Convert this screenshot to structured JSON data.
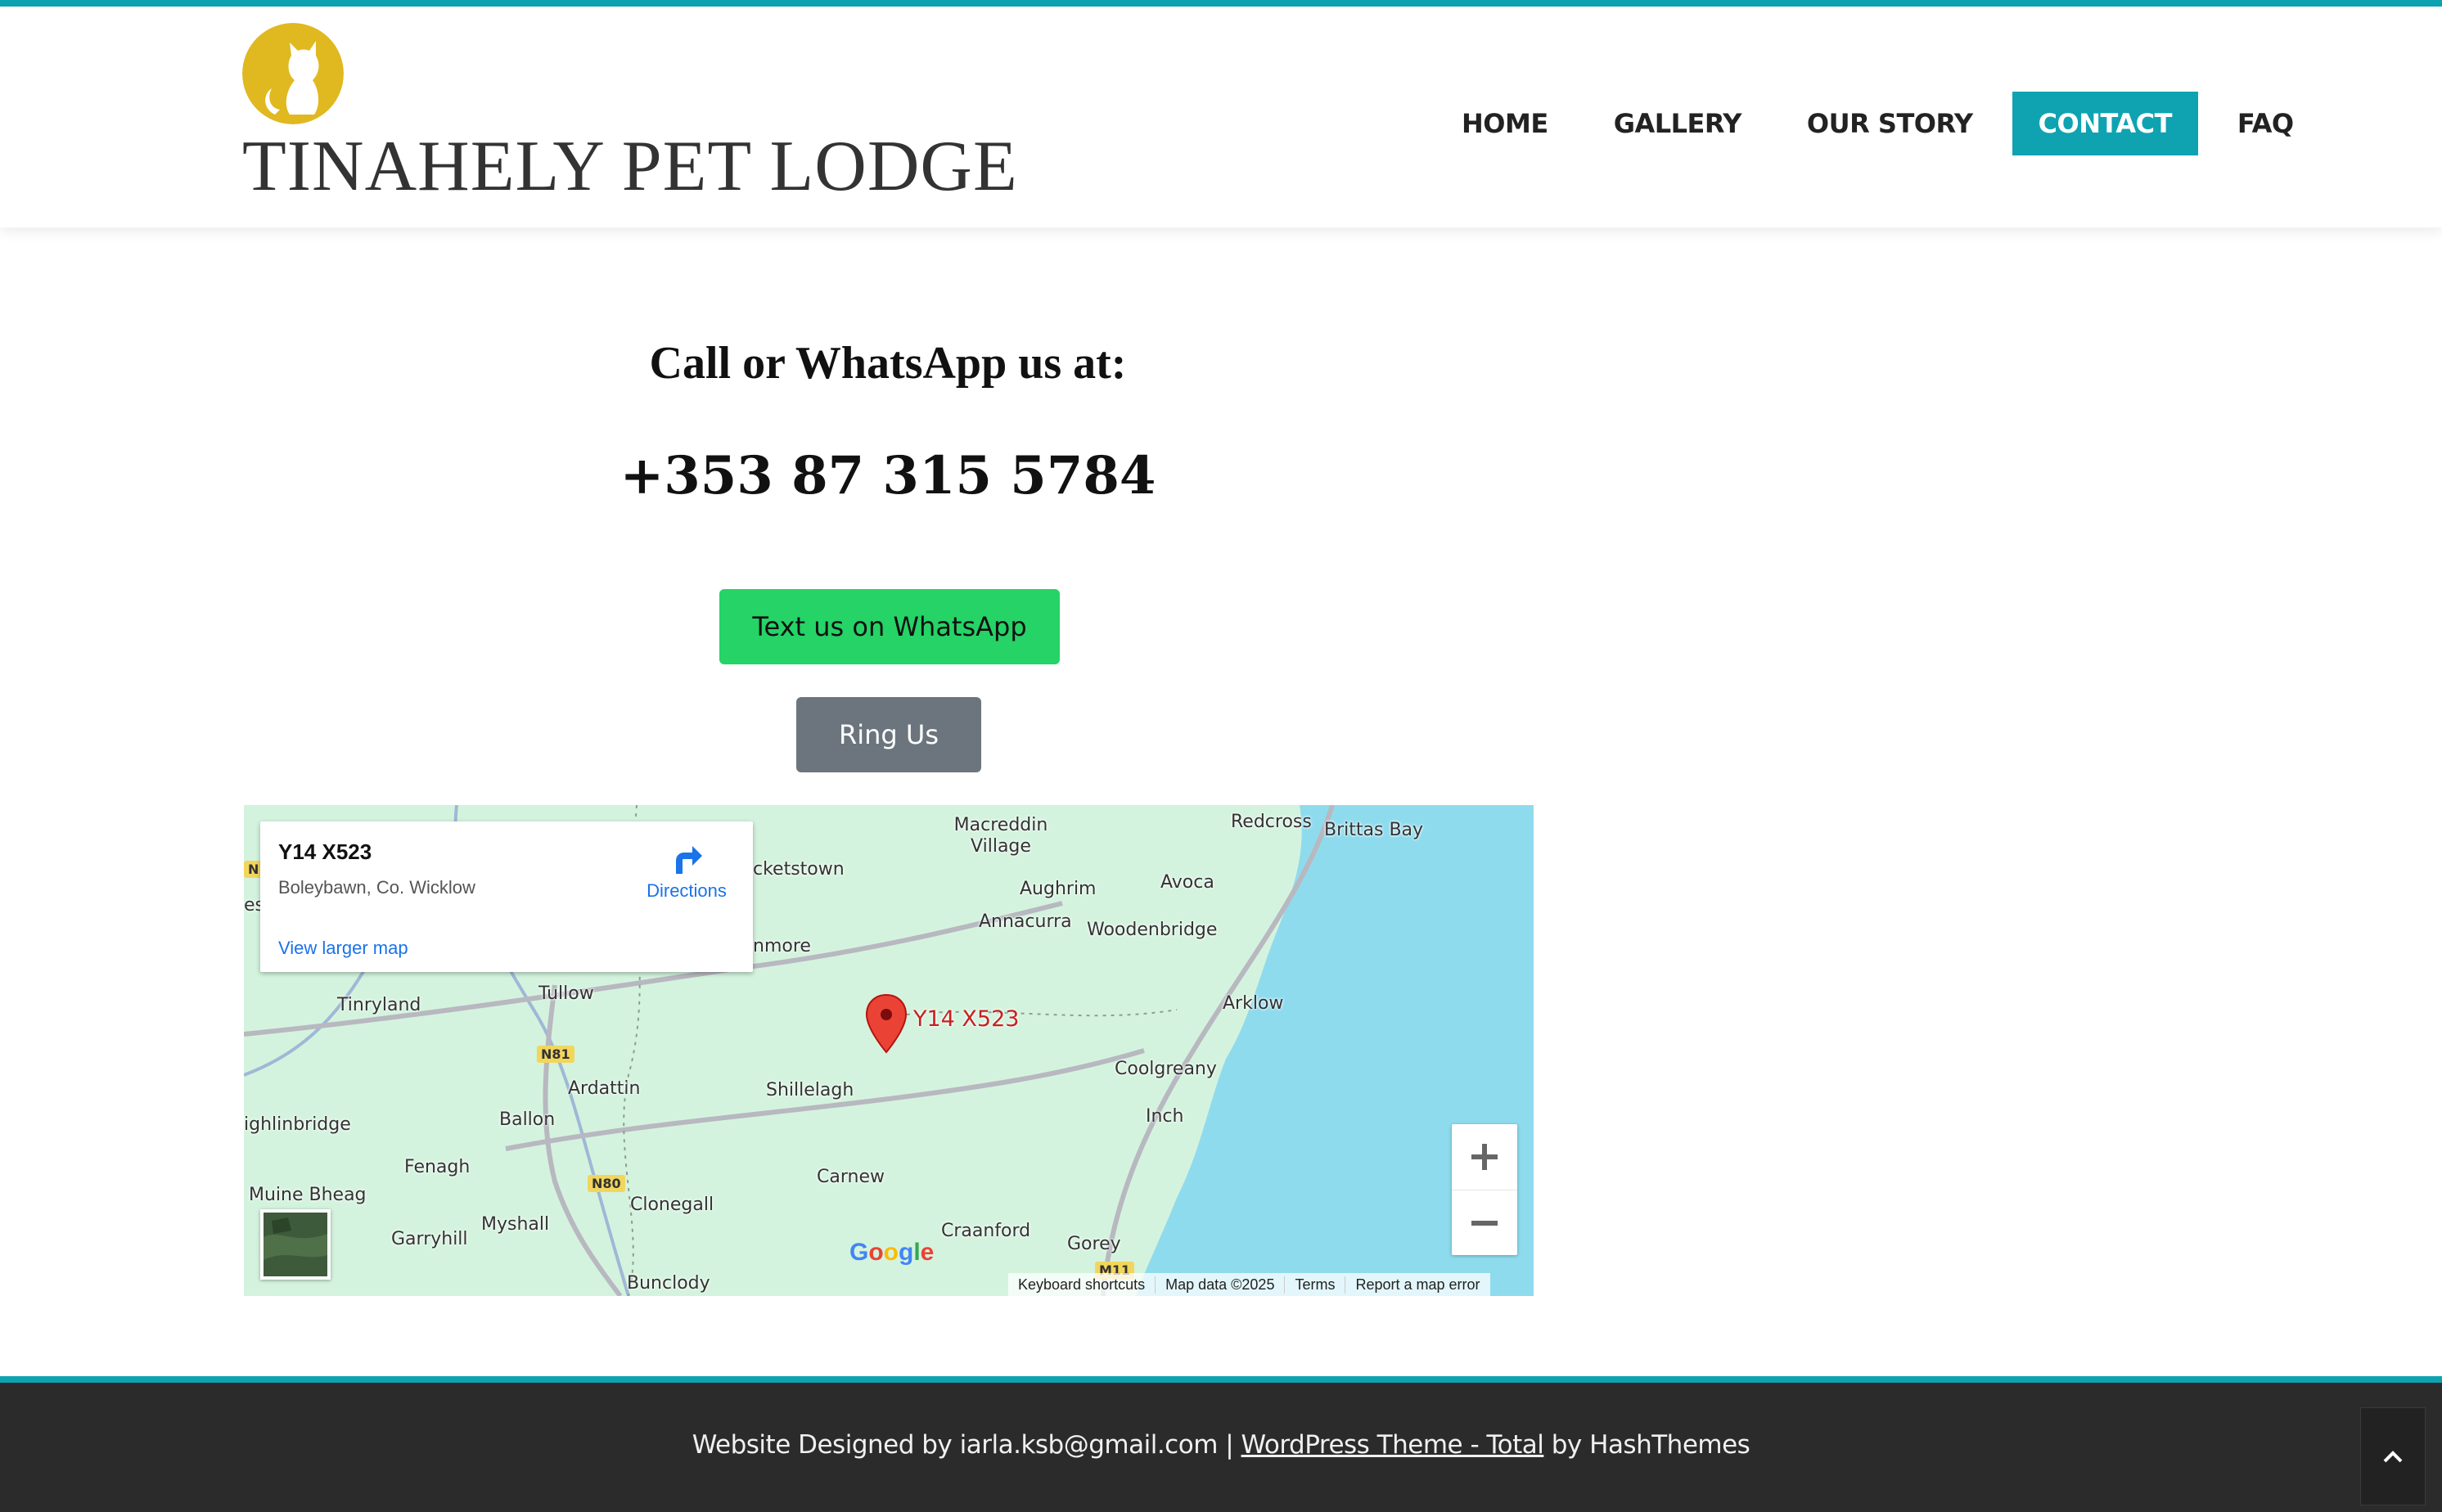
{
  "colors": {
    "accent": "#0fa3b1",
    "logo": "#e0b820",
    "whatsapp": "#25d366",
    "ring": "#6c757d",
    "footer_bg": "#2b2b2b",
    "map_land": "#d4f3de",
    "map_water": "#8fdbee",
    "pin": "#ea4335"
  },
  "header": {
    "logo_icon": "cat-icon",
    "site_title": "TINAHELY PET LODGE",
    "nav": [
      {
        "label": "HOME",
        "active": false
      },
      {
        "label": "GALLERY",
        "active": false
      },
      {
        "label": "OUR STORY",
        "active": false
      },
      {
        "label": "CONTACT",
        "active": true
      },
      {
        "label": "FAQ",
        "active": false
      }
    ]
  },
  "contact": {
    "heading": "Call or WhatsApp us at:",
    "phone": "+353 87 315 5784",
    "whatsapp_button": "Text us on WhatsApp",
    "ring_button": "Ring Us"
  },
  "map": {
    "card": {
      "title": "Y14 X523",
      "address": "Boleybawn, Co. Wicklow",
      "directions_label": "Directions",
      "larger_map_link": "View larger map"
    },
    "pin_label": "Y14 X523",
    "places": [
      "Macreddin Village",
      "Redcross",
      "Brittas Bay",
      "cketstown",
      "Aughrim",
      "Avoca",
      "Annacurra",
      "Woodenbridge",
      "nmore",
      "Tullow",
      "Tinryland",
      "Arklow",
      "Ardattin",
      "Shillelagh",
      "Coolgreany",
      "Ballon",
      "ighlinbridge",
      "Inch",
      "Fenagh",
      "Carnew",
      "Muine Bheag",
      "Clonegall",
      "Myshall",
      "Garryhill",
      "Craanford",
      "Gorey",
      "Bunclody",
      "es"
    ],
    "road_badges": [
      "N81",
      "N80",
      "M11",
      "N"
    ],
    "google_logo": "Google",
    "attribution": [
      "Keyboard shortcuts",
      "Map data ©2025",
      "Terms",
      "Report a map error"
    ],
    "zoom_in_icon": "plus-icon",
    "zoom_out_icon": "minus-icon"
  },
  "footer": {
    "prefix": "Website Designed by iarla.ksb@gmail.com |",
    "theme_link": "WordPress Theme - Total",
    "suffix": "by HashThemes",
    "back_to_top_icon": "chevron-up-icon"
  }
}
